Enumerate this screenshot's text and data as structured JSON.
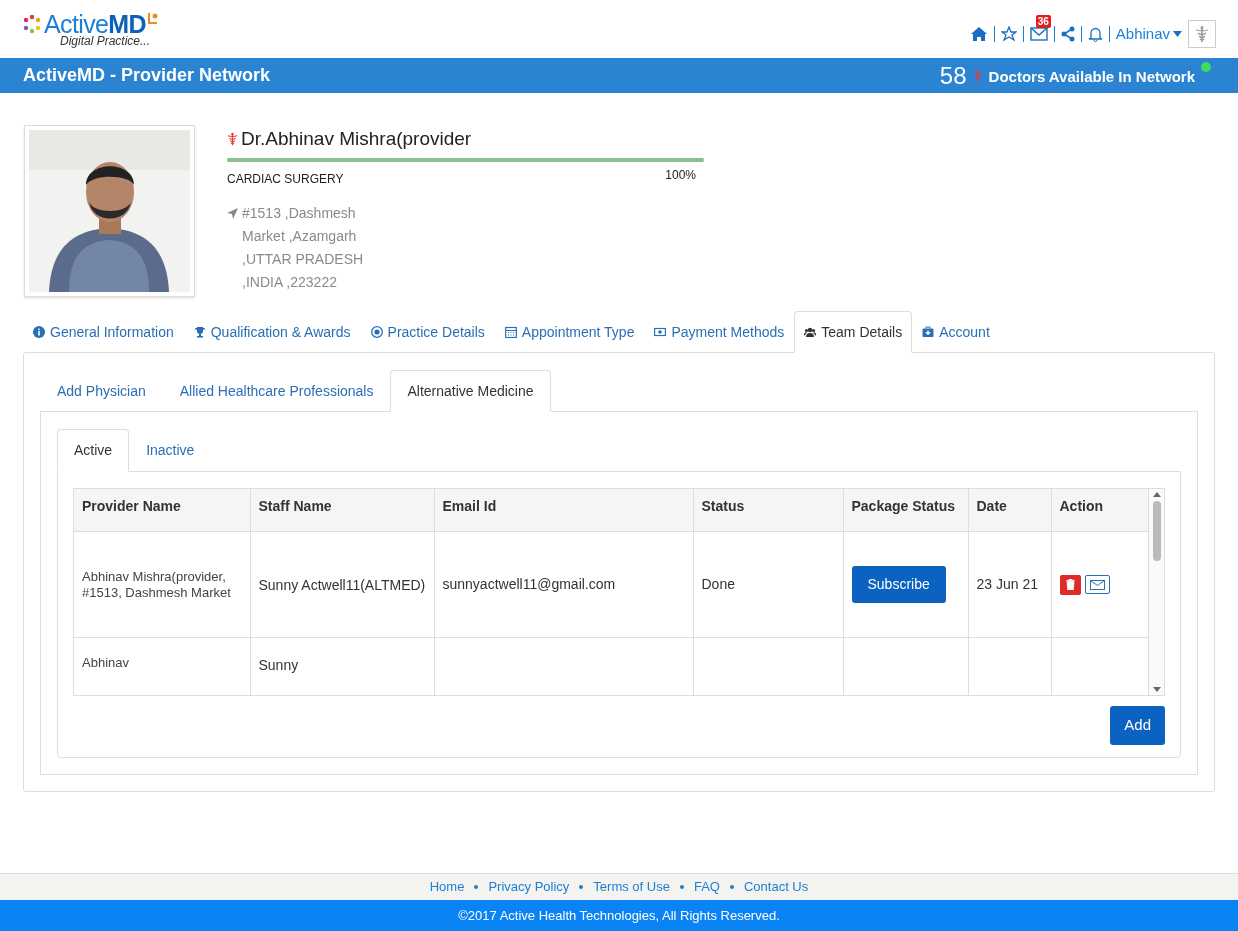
{
  "logo": {
    "word": "Active",
    "accent": "MD",
    "tagline": "Digital Practice..."
  },
  "top_nav": {
    "badge": "36",
    "user": "Abhinav"
  },
  "banner": {
    "title": "ActiveMD - Provider Network",
    "count": "58",
    "label": "Doctors Available In Network",
    "online": true
  },
  "profile": {
    "name": "Dr.Abhinav Mishra(provider",
    "specialty": "CARDIAC SURGERY",
    "level": 1,
    "completion": "100%",
    "address_lines": [
      "#1513 ,Dashmesh",
      "Market ,Azamgarh",
      ",UTTAR PRADESH",
      ",INDIA ,223222"
    ]
  },
  "tabs": [
    {
      "label": "General Information",
      "selected": false
    },
    {
      "label": "Qualification & Awards",
      "selected": false
    },
    {
      "label": "Practice Details",
      "selected": false
    },
    {
      "label": "Appointment Type",
      "selected": false
    },
    {
      "label": "Payment Methods",
      "selected": false
    },
    {
      "label": "Team Details",
      "selected": true
    },
    {
      "label": "Account",
      "selected": false
    }
  ],
  "sub_tabs": [
    {
      "label": "Add Physician",
      "selected": false
    },
    {
      "label": "Allied Healthcare Professionals",
      "selected": false
    },
    {
      "label": "Alternative Medicine",
      "selected": true
    }
  ],
  "status_tabs": [
    {
      "label": "Active",
      "selected": true
    },
    {
      "label": "Inactive",
      "selected": false
    }
  ],
  "table": {
    "columns": [
      "Provider Name",
      "Staff Name",
      "Email Id",
      "Status",
      "Package Status",
      "Date",
      "Action"
    ],
    "rows": [
      {
        "provider": "Abhinav Mishra(provider, #1513, Dashmesh Market",
        "staff": "Sunny Actwell11(ALTMED)",
        "email": "sunnyactwell11@gmail.com",
        "status": "Done",
        "package": "Subscribe",
        "date": "23 Jun 21"
      },
      {
        "provider": "Abhinav",
        "staff": "Sunny"
      }
    ]
  },
  "add_button": "Add",
  "footer": {
    "links": [
      "Home",
      "Privacy Policy",
      "Terms of Use",
      "FAQ",
      "Contact Us"
    ],
    "copyright": "©2017 Active Health Technologies, All Rights Reserved."
  }
}
